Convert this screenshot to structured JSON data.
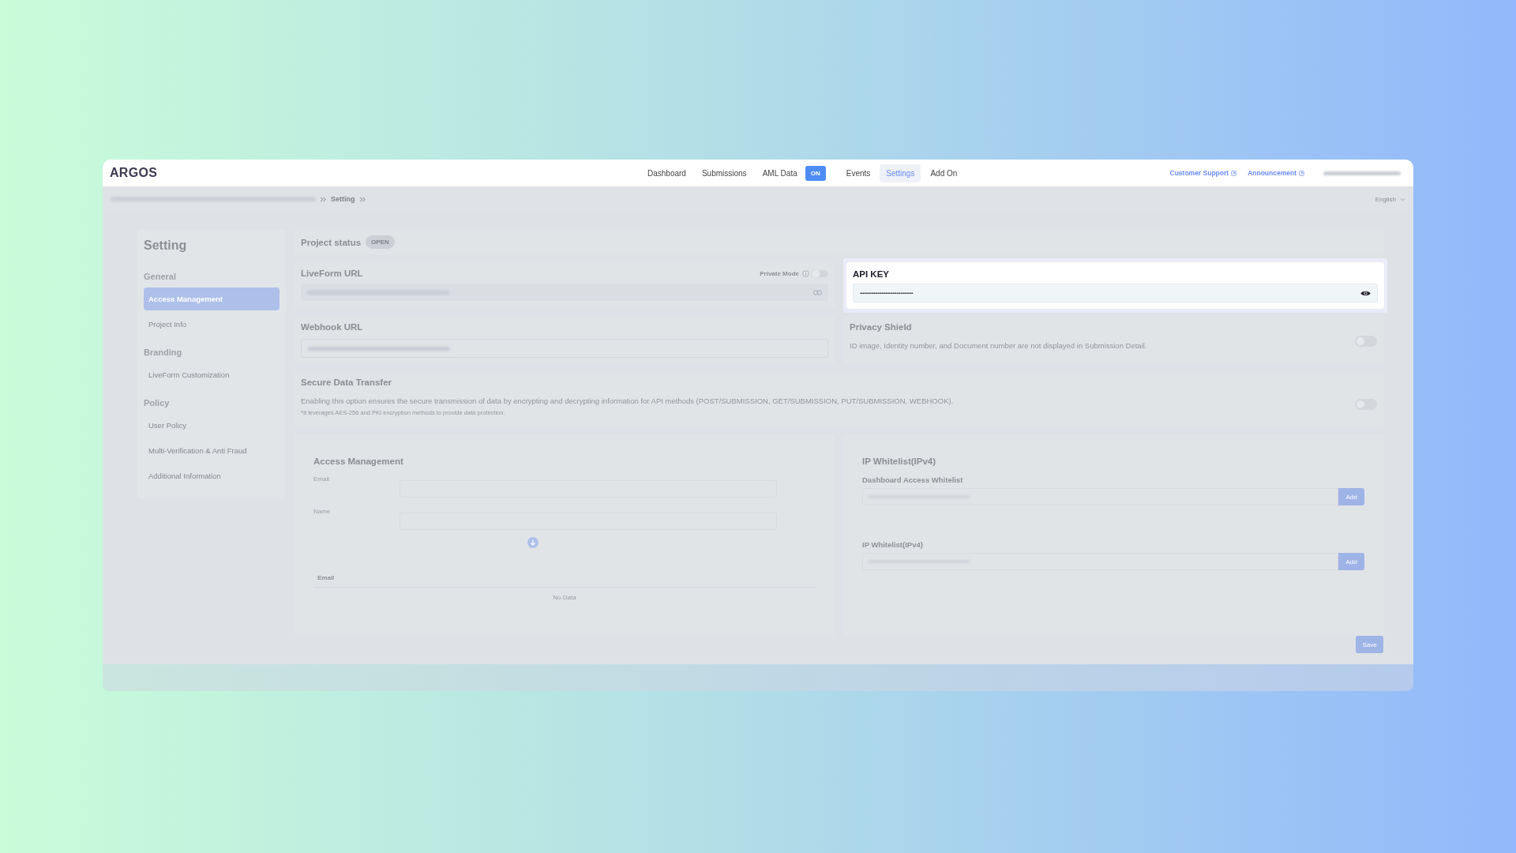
{
  "header": {
    "logo": "ARGOS",
    "nav": [
      {
        "label": "Dashboard",
        "selected": false
      },
      {
        "label": "Submissions",
        "selected": false
      },
      {
        "label": "AML Data",
        "selected": false,
        "badge": "ON"
      },
      {
        "label": "Events",
        "selected": false
      },
      {
        "label": "Settings",
        "selected": true
      },
      {
        "label": "Add On",
        "selected": false
      }
    ],
    "links": [
      "Customer Support",
      "Announcement"
    ]
  },
  "breadcrumb": {
    "current": "Setting"
  },
  "language": "English",
  "sidebar": {
    "title": "Setting",
    "groups": [
      {
        "label": "General",
        "items": [
          {
            "label": "Access Management",
            "selected": true
          },
          {
            "label": "Project Info",
            "selected": false
          }
        ]
      },
      {
        "label": "Branding",
        "items": [
          {
            "label": "LiveForm Customization",
            "selected": false
          }
        ]
      },
      {
        "label": "Policy",
        "items": [
          {
            "label": "User Policy",
            "selected": false
          },
          {
            "label": "Multi-Verification & Anti Fraud",
            "selected": false
          },
          {
            "label": "Additional Information",
            "selected": false
          }
        ]
      }
    ]
  },
  "project_status": {
    "label": "Project status",
    "badge": "OPEN"
  },
  "liveform": {
    "title": "LiveForm URL",
    "private_mode": {
      "label": "Private Mode",
      "on": false
    }
  },
  "api_key": {
    "title": "API KEY",
    "value": "••••••••••••••••••••••••••••••••••••••••••"
  },
  "webhook": {
    "title": "Webhook URL"
  },
  "privacy_shield": {
    "title": "Privacy Shield",
    "description": "ID image, Identity number, and Document number are not displayed in Submission Detail.",
    "on": false
  },
  "secure_transfer": {
    "title": "Secure Data Transfer",
    "description": "Enabling this option ensures the secure transmission of data by encrypting and decrypting information for API methods (POST/SUBMISSION, GET/SUBMISSION, PUT/SUBMISSION, WEBHOOK).",
    "note": "*It leverages AES-256 and PKI encryption methods to provide data protection.",
    "on": false
  },
  "access_management": {
    "title": "Access Management",
    "fields": [
      {
        "label": "Email"
      },
      {
        "label": "Name"
      }
    ],
    "table": {
      "columns": [
        "Email"
      ],
      "empty": "No Data"
    }
  },
  "ip_whitelist": {
    "title": "IP Whitelist(IPv4)",
    "lists": [
      {
        "label": "Dashboard Access Whitelist",
        "button": "Add"
      },
      {
        "label": "IP Whitelist(IPv4)",
        "button": "Add"
      }
    ]
  },
  "save_button": "Save"
}
